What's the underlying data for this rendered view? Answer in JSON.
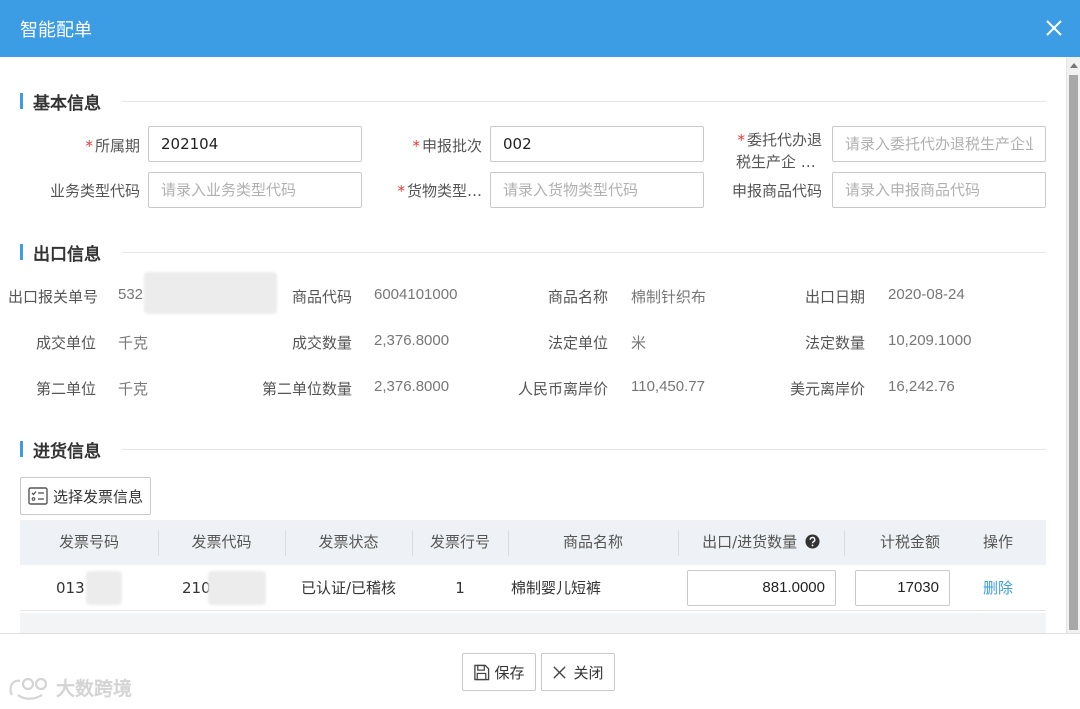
{
  "window": {
    "title": "智能配单"
  },
  "sections": {
    "basic": "基本信息",
    "export": "出口信息",
    "purchase": "进货信息"
  },
  "basic_form": {
    "period": {
      "label": "所属期",
      "value": "202104"
    },
    "batch": {
      "label": "申报批次",
      "value": "002"
    },
    "entrust": {
      "label_line1": "委托代办退",
      "label_line2": "税生产企 …",
      "placeholder": "请录入委托代办退税生产企业纳"
    },
    "biz_type": {
      "label": "业务类型代码",
      "placeholder": "请录入业务类型代码"
    },
    "goods_type": {
      "label": "货物类型…",
      "placeholder": "请录入货物类型代码"
    },
    "decl_goods": {
      "label": "申报商品代码",
      "placeholder": "请录入申报商品代码"
    }
  },
  "export_info": {
    "customs_no": {
      "label": "出口报关单号",
      "value": "532"
    },
    "goods_code": {
      "label": "商品代码",
      "value": "6004101000"
    },
    "goods_name": {
      "label": "商品名称",
      "value": "棉制针织布"
    },
    "export_date": {
      "label": "出口日期",
      "value": "2020-08-24"
    },
    "deal_unit": {
      "label": "成交单位",
      "value": "千克"
    },
    "deal_qty": {
      "label": "成交数量",
      "value": "2,376.8000"
    },
    "legal_unit": {
      "label": "法定单位",
      "value": "米"
    },
    "legal_qty": {
      "label": "法定数量",
      "value": "10,209.1000"
    },
    "second_unit": {
      "label": "第二单位",
      "value": "千克"
    },
    "second_qty": {
      "label": "第二单位数量",
      "value": "2,376.8000"
    },
    "rmb_fob": {
      "label": "人民币离岸价",
      "value": "110,450.77"
    },
    "usd_fob": {
      "label": "美元离岸价",
      "value": "16,242.76"
    }
  },
  "purchase": {
    "select_invoice_label": "选择发票信息",
    "columns": [
      "发票号码",
      "发票代码",
      "发票状态",
      "发票行号",
      "商品名称",
      "出口/进货数量",
      "计税金额",
      "操作"
    ],
    "rows": [
      {
        "invoice_no": "013",
        "invoice_code": "210",
        "status": "已认证/已稽核",
        "line_no": "1",
        "goods_name": "棉制婴儿短裤",
        "qty": "881.0000",
        "amount": "17030",
        "action": "删除"
      }
    ]
  },
  "footer": {
    "save": "保存",
    "close": "关闭"
  },
  "watermark": "大数跨境",
  "colors": {
    "header": "#3c9ce4",
    "required": "#e53935",
    "link": "#3c9ce4"
  }
}
